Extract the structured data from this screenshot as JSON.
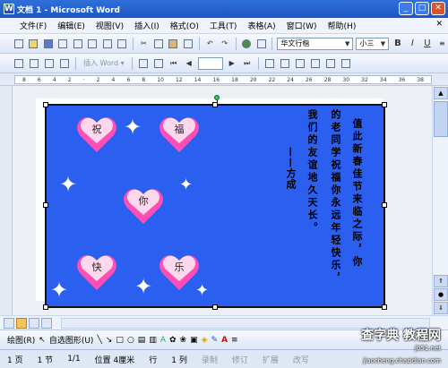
{
  "window": {
    "title": "文档 1 - Microsoft Word",
    "app_icon": "W"
  },
  "menu": [
    "文件(F)",
    "编辑(E)",
    "视图(V)",
    "插入(I)",
    "格式(O)",
    "工具(T)",
    "表格(A)",
    "窗口(W)",
    "帮助(H)"
  ],
  "toolbar": {
    "font_name": "华文行楷",
    "font_size": "小三"
  },
  "toolbar2": {
    "insert_word_label": "插入 Word ▾"
  },
  "ruler": {
    "marks": [
      "8",
      "6",
      "4",
      "2",
      "",
      "2",
      "4",
      "6",
      "8",
      "10",
      "12",
      "14",
      "16",
      "18",
      "20",
      "22",
      "24",
      "26",
      "28",
      "30",
      "32",
      "34",
      "36",
      "38"
    ]
  },
  "canvas": {
    "hearts": [
      "祝",
      "福",
      "你",
      "快",
      "乐"
    ],
    "poem_columns": [
      "值此新春佳节来临之际，你",
      "的老同学祝福你永远年轻快乐，",
      "我们的友谊地久天长。",
      "——方成"
    ]
  },
  "drawing_bar": {
    "draw_label": "绘图(R)",
    "autoshape_label": "自选图形(U)"
  },
  "status": {
    "page": "1 页",
    "section": "1 节",
    "pages": "1/1",
    "position": "位置 4厘米",
    "line": "行",
    "col": "1 列",
    "rec": "录制",
    "trk": "修订",
    "ext": "扩展",
    "ovr": "改写"
  },
  "watermark": {
    "line1": "查字典 教程网",
    "line2": "jb51.net",
    "line3": "jiaocheng.chazidian.com"
  },
  "colors": {
    "canvas_bg": "#2b5ff0",
    "heart_top": "#ffd8ee",
    "heart_side": "#ff4fb6",
    "title_bar": "#1d56c4"
  }
}
